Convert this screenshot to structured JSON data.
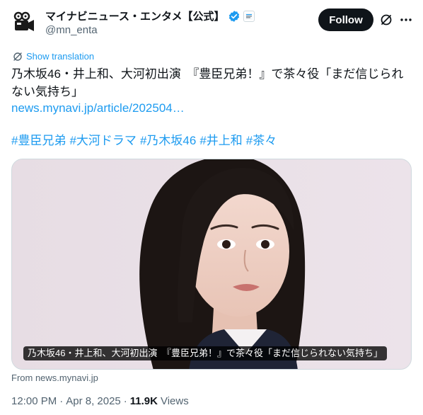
{
  "account": {
    "display_name": "マイナビニュース・エンタメ【公式】",
    "handle": "@mn_enta",
    "verified_icon": "verified-badge-icon",
    "verified_color": "#1d9bf0"
  },
  "actions": {
    "follow_label": "Follow"
  },
  "tweet": {
    "translate_label": "Show translation",
    "text": "乃木坂46・井上和、大河初出演　『豊臣兄弟！』で茶々役「まだ信じられない気持ち」",
    "link_text": "news.mynavi.jp/article/202504…",
    "hashtags": [
      "#豊臣兄弟",
      "#大河ドラマ",
      "#乃木坂46",
      "#井上和",
      "#茶々"
    ]
  },
  "media": {
    "caption": "乃木坂46・井上和、大河初出演　『豊臣兄弟！』で茶々役「まだ信じられない気持ち」",
    "source": "From news.mynavi.jp"
  },
  "meta": {
    "time": "12:00 PM",
    "separator": "·",
    "date": "Apr 8, 2025",
    "separator2": "·",
    "views_count": "11.9K",
    "views_label": "Views"
  },
  "colors": {
    "accent": "#1d9bf0",
    "text_primary": "#0f1419",
    "text_secondary": "#536471",
    "follow_bg": "#0f1419"
  }
}
